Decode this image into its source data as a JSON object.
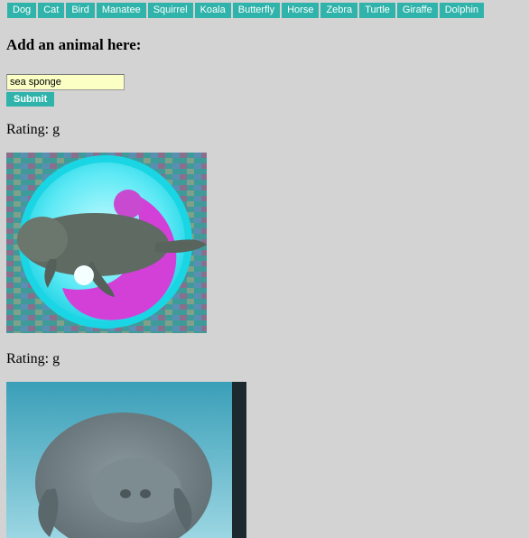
{
  "nav": {
    "buttons": [
      "Dog",
      "Cat",
      "Bird",
      "Manatee",
      "Squirrel",
      "Koala",
      "Butterfly",
      "Horse",
      "Zebra",
      "Turtle",
      "Giraffe",
      "Dolphin"
    ]
  },
  "form": {
    "heading": "Add an animal here:",
    "input_value": "sea sponge",
    "submit_label": "Submit"
  },
  "results": [
    {
      "rating": "Rating: g",
      "image": "manatee-gif-pink-bubble"
    },
    {
      "rating": "Rating: g",
      "image": "manatee-gif-aquarium"
    }
  ],
  "colors": {
    "background": "#d3d3d3",
    "button": "#2fb3aa",
    "input_bg": "#fbffc4"
  }
}
